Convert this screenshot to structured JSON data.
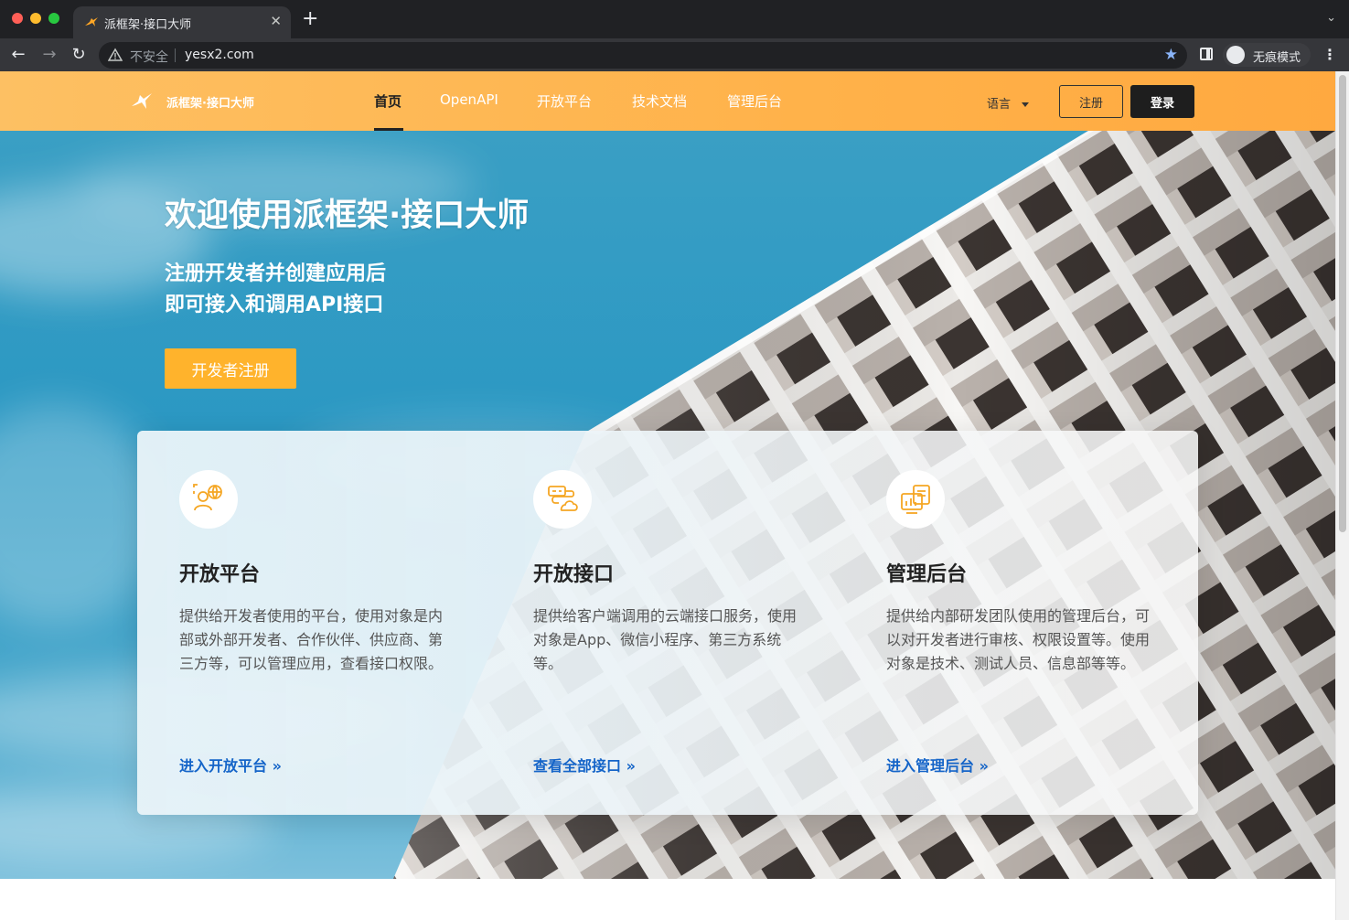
{
  "browser": {
    "tab_title": "派框架·接口大师",
    "insecure_label": "不安全",
    "url": "yesx2.com",
    "incognito_label": "无痕模式"
  },
  "site": {
    "logo_text": "派框架·接口大师",
    "nav": [
      "首页",
      "OpenAPI",
      "开放平台",
      "技术文档",
      "管理后台"
    ],
    "active_nav": "首页",
    "language_label": "语言",
    "register_button": "注册",
    "login_button": "登录"
  },
  "hero": {
    "title": "欢迎使用派框架·接口大师",
    "subtitle_line1": "注册开发者并创建应用后",
    "subtitle_line2": "即可接入和调用API接口",
    "cta_label": "开发者注册"
  },
  "features": [
    {
      "icon": "user-globe-icon",
      "title": "开放平台",
      "description": "提供给开发者使用的平台，使用对象是内部或外部开发者、合作伙伴、供应商、第三方等，可以管理应用，查看接口权限。",
      "link": "进入开放平台 »"
    },
    {
      "icon": "api-cloud-icon",
      "title": "开放接口",
      "description": "提供给客户端调用的云端接口服务，使用对象是App、微信小程序、第三方系统等。",
      "link": "查看全部接口 »"
    },
    {
      "icon": "dashboard-admin-icon",
      "title": "管理后台",
      "description": "提供给内部研发团队使用的管理后台，可以对开发者进行审核、权限设置等。使用对象是技术、测试人员、信息部等等。",
      "link": "进入管理后台 »"
    }
  ],
  "colors": {
    "header_orange": "#ffb24a",
    "accent_yellow": "#ffb32c",
    "link_blue": "#1464c8",
    "sky_blue": "#2b98c3"
  }
}
